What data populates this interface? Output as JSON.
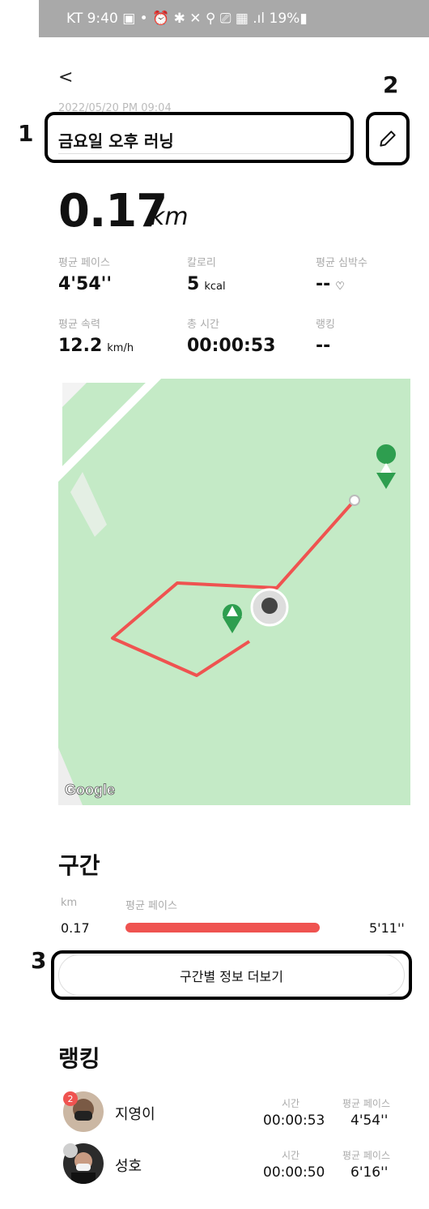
{
  "status_bar": {
    "text": "KT 9:40 ▣ •  ⏰ ✱ ✕ ⚲ ⎚ ▦ .ıl 19%▮"
  },
  "header": {
    "back_icon": "chevron-left-icon",
    "back_glyph": "<",
    "date": "2022/05/20 PM 09:04",
    "title": "금요일 오후 러닝",
    "edit_icon": "pencil-icon"
  },
  "annotations": {
    "label1": "1",
    "label2": "2",
    "label3": "3"
  },
  "summary": {
    "distance": "0.17",
    "distance_unit": "km",
    "stats": [
      {
        "label": "평균 페이스",
        "value": "4'54''",
        "unit": ""
      },
      {
        "label": "칼로리",
        "value": "5",
        "unit": "kcal"
      },
      {
        "label": "평균 심박수",
        "value": "--",
        "unit": "♡"
      },
      {
        "label": "평균 속력",
        "value": "12.2",
        "unit": "km/h"
      },
      {
        "label": "총 시간",
        "value": "00:00:53",
        "unit": ""
      },
      {
        "label": "랭킹",
        "value": "--",
        "unit": ""
      }
    ]
  },
  "map": {
    "attribution": "Google",
    "route_color": "#ef5350",
    "background_color": "#c4eac6",
    "marker_color": "#2e9e4f"
  },
  "segments": {
    "title": "구간",
    "col_km": "km",
    "col_pace": "평균 페이스",
    "rows": [
      {
        "km": "0.17",
        "pace": "5'11''"
      }
    ],
    "more_button": "구간별 정보 더보기"
  },
  "ranking": {
    "title": "랭킹",
    "time_label": "시간",
    "pace_label": "평균 페이스",
    "rows": [
      {
        "rank": "2",
        "name": "지영이",
        "time": "00:00:53",
        "pace": "4'54''"
      },
      {
        "rank": "",
        "name": "성호",
        "time": "00:00:50",
        "pace": "6'16''"
      }
    ]
  }
}
